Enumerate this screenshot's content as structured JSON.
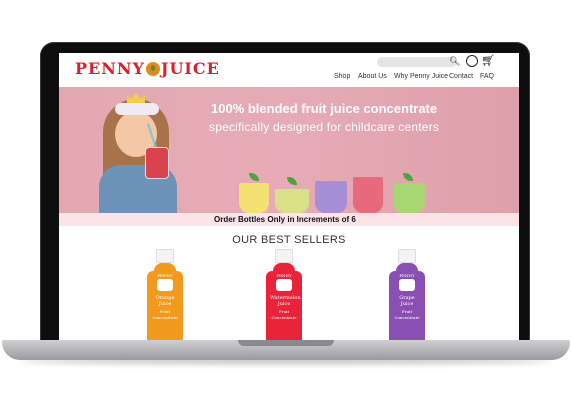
{
  "site": {
    "logo_text_left": "PENNY",
    "logo_text_right": "JUICE",
    "brand_color": "#d9212a"
  },
  "nav": {
    "items": [
      "Shop",
      "About Us",
      "Why Penny Juice",
      "Contact",
      "FAQ"
    ]
  },
  "icons": [
    "search-icon",
    "account-icon",
    "cart-icon"
  ],
  "hero": {
    "title": "100% blended fruit juice concentrate",
    "subtitle": "specifically designed for childcare centers",
    "background": "#e3a8b1"
  },
  "banner": {
    "text": "Order Bottles Only in Increments of 6"
  },
  "best_sellers": {
    "heading": "OUR BEST SELLERS",
    "products": [
      {
        "brand": "PENNY JUICE",
        "name": "Orange Juice",
        "type": "Fruit Concentrate",
        "color": "#f29a1e"
      },
      {
        "brand": "PENNY JUICE",
        "name": "Watermelon Juice",
        "type": "Fruit Concentrate",
        "color": "#e8233a"
      },
      {
        "brand": "PENNY JUICE",
        "name": "Grape Juice",
        "type": "Fruit Concentrate",
        "color": "#8a4fb3"
      }
    ]
  }
}
